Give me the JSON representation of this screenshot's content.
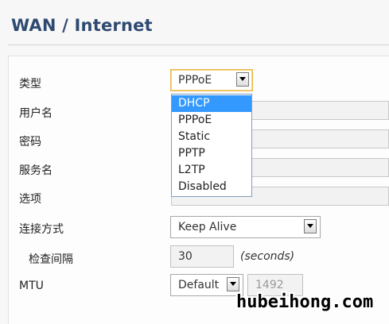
{
  "header": {
    "title": "WAN / Internet"
  },
  "form": {
    "type_label": "类型",
    "type_value": "PPPoE",
    "username_label": "用户名",
    "password_label": "密码",
    "service_label": "服务名",
    "options_label": "选项",
    "connection_label": "连接方式",
    "connection_value": "Keep Alive",
    "check_interval_label": "检查间隔",
    "check_interval_value": "30",
    "check_interval_unit": "(seconds)",
    "mtu_label": "MTU",
    "mtu_mode_value": "Default",
    "mtu_value": "1492"
  },
  "type_dropdown": {
    "options": [
      "DHCP",
      "PPPoE",
      "Static",
      "PPTP",
      "L2TP",
      "Disabled"
    ],
    "highlighted_index": 0
  },
  "watermark": "hubeihong.com",
  "icons": {
    "dropdown_arrow": "chevron-down-icon"
  }
}
